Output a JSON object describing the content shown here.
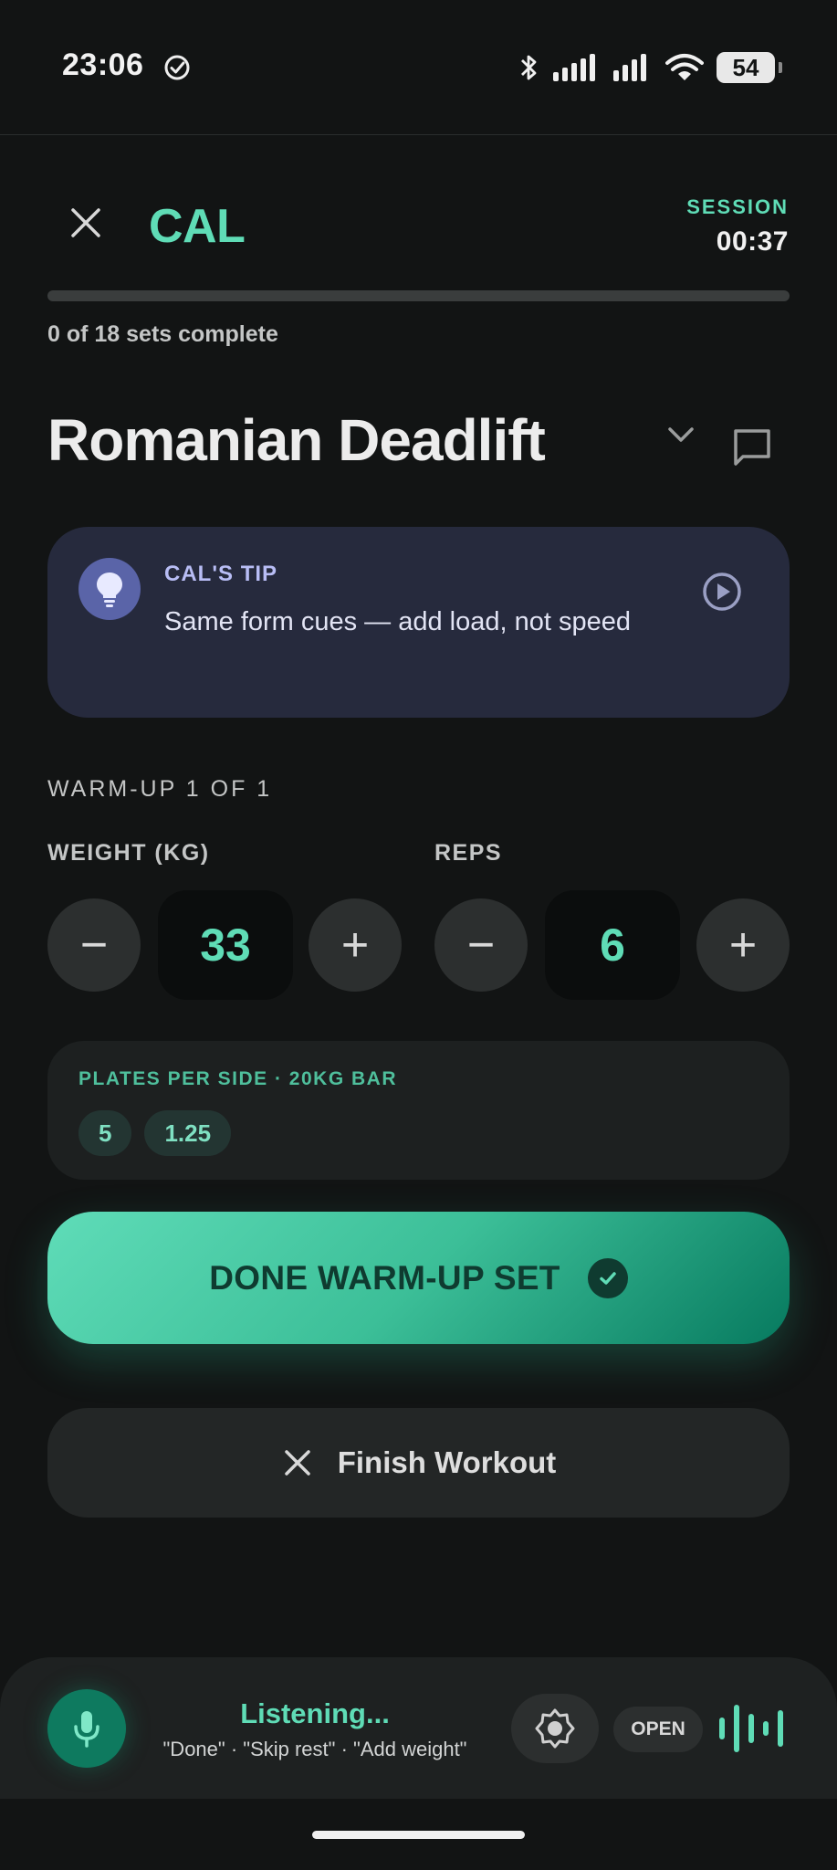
{
  "status_bar": {
    "time": "23:06",
    "battery": "54",
    "icons": [
      "check-circle-icon",
      "bluetooth-icon",
      "signal-icon",
      "signal-icon",
      "wifi-icon",
      "battery-icon"
    ]
  },
  "header": {
    "app_name": "CAL",
    "session_label": "SESSION",
    "session_time": "00:37"
  },
  "progress": {
    "completed": 0,
    "total": 18,
    "text": "0 of 18 sets complete"
  },
  "exercise": {
    "name": "Romanian Deadlift"
  },
  "tip": {
    "label": "CAL'S TIP",
    "text": "Same form cues — add load, not speed"
  },
  "set": {
    "label": "WARM-UP 1 OF 1",
    "weight_label": "WEIGHT (KG)",
    "weight_value": "33",
    "reps_label": "REPS",
    "reps_value": "6",
    "minus": "−",
    "plus": "+"
  },
  "plates": {
    "label": "PLATES PER SIDE · 20KG BAR",
    "items": [
      "5",
      "1.25"
    ]
  },
  "actions": {
    "done_label": "DONE WARM-UP SET",
    "finish_label": "Finish Workout"
  },
  "voice": {
    "status": "Listening...",
    "hints": "\"Done\" · \"Skip rest\" · \"Add weight\"",
    "open_label": "OPEN"
  },
  "colors": {
    "accent": "#5fdcb6",
    "background": "#121414",
    "tip_bg": "#262a3d",
    "done_gradient_start": "#5fdcb8",
    "done_gradient_end": "#077a5f"
  }
}
